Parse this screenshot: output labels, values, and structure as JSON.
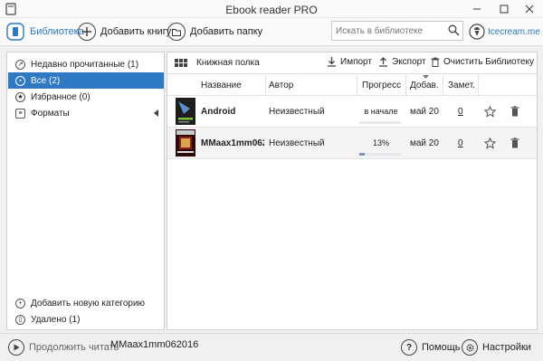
{
  "window": {
    "title": "Ebook reader PRO"
  },
  "toolbar": {
    "library": "Библиотека",
    "add_book": "Добавить книгу",
    "add_folder": "Добавить папку",
    "brand": "Icecream.me"
  },
  "search": {
    "placeholder": "Искать в библиотеке"
  },
  "sidebar": {
    "items": [
      {
        "label": "Недавно прочитанные (1)"
      },
      {
        "label": "Все (2)",
        "active": true
      },
      {
        "label": "Избранное (0)"
      },
      {
        "label": "Форматы"
      }
    ],
    "add_category": "Добавить новую категорию",
    "deleted": "Удалено (1)"
  },
  "main": {
    "shelf_label": "Книжная полка",
    "import": "Импорт",
    "export": "Экспорт",
    "clear": "Очистить Библиотеку",
    "columns": [
      "Название",
      "Автор",
      "Прогресс",
      "Добав.",
      "Замет."
    ],
    "books": [
      {
        "cover": "Android",
        "title": "Android",
        "author": "Неизвестный",
        "progress_text": "в начале",
        "progress": 0.0,
        "added": "май 20",
        "notes": "0"
      },
      {
        "cover": "MAXIM",
        "title": "MMaax1mm062016",
        "author": "Неизвестный",
        "progress_text": "13%",
        "progress": 0.13,
        "added": "май 20",
        "notes": "0"
      }
    ]
  },
  "statusbar": {
    "continue": "Продолжить читать",
    "current_book": "MMaax1mm062016",
    "help": "Помощь",
    "settings": "Настройки"
  },
  "colors": {
    "accent": "#2f78c4",
    "brand": "#2f7ab8",
    "progress": "#7f94b8"
  }
}
